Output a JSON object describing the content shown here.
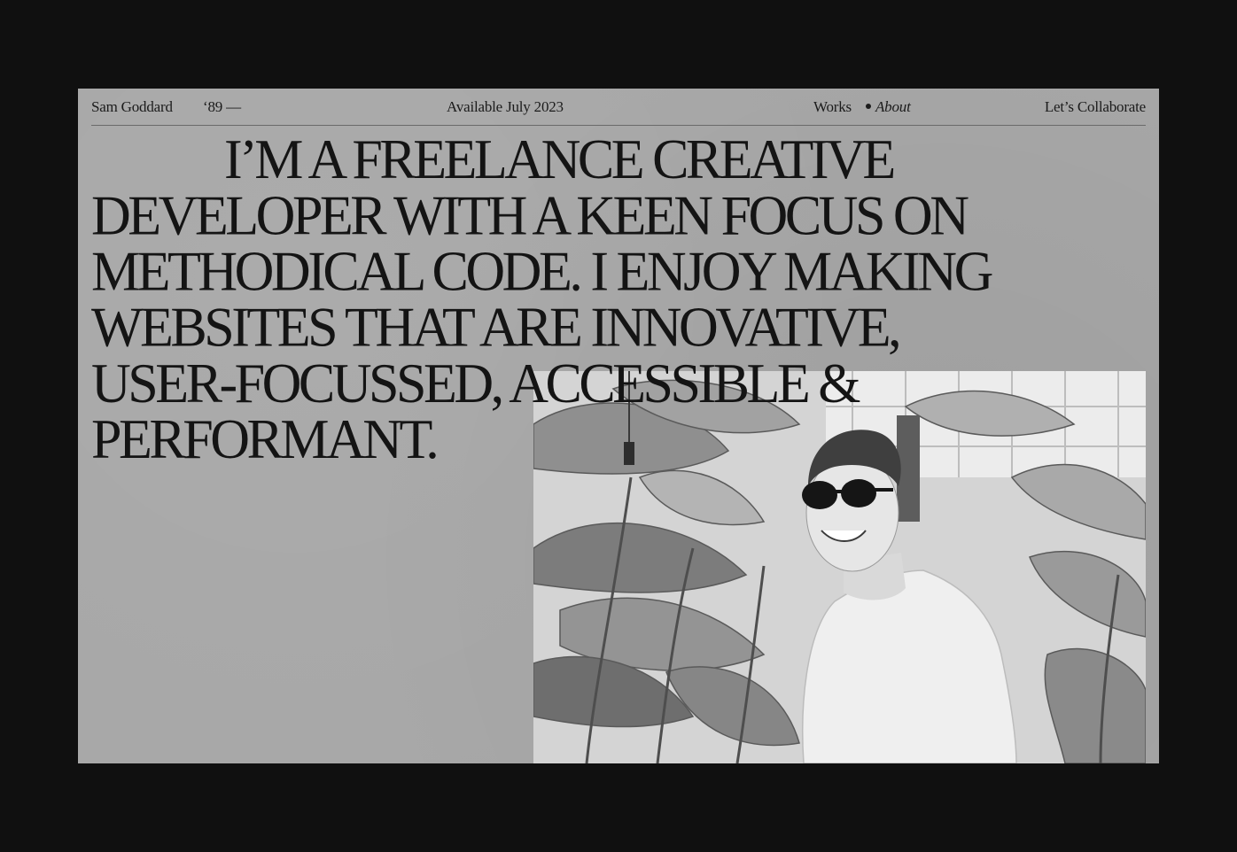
{
  "nav": {
    "name": "Sam Goddard",
    "year": "‘89 —",
    "availability": "Available July 2023",
    "works_label": "Works",
    "about_label": "About",
    "collaborate_label": "Let’s Collaborate"
  },
  "hero": {
    "lines": [
      "I’M A FREELANCE CREATIVE",
      "DEVELOPER WITH A KEEN FOCUS ON",
      "METHODICAL CODE. I ENJOY MAKING",
      "WEBSITES THAT ARE INNOVATIVE,",
      "USER-FOCUSSED, ACCESSIBLE &",
      "PERFORMANT."
    ]
  },
  "colors": {
    "page_background": "#101010",
    "panel_background": "#a7a7a7",
    "text": "#141414"
  }
}
